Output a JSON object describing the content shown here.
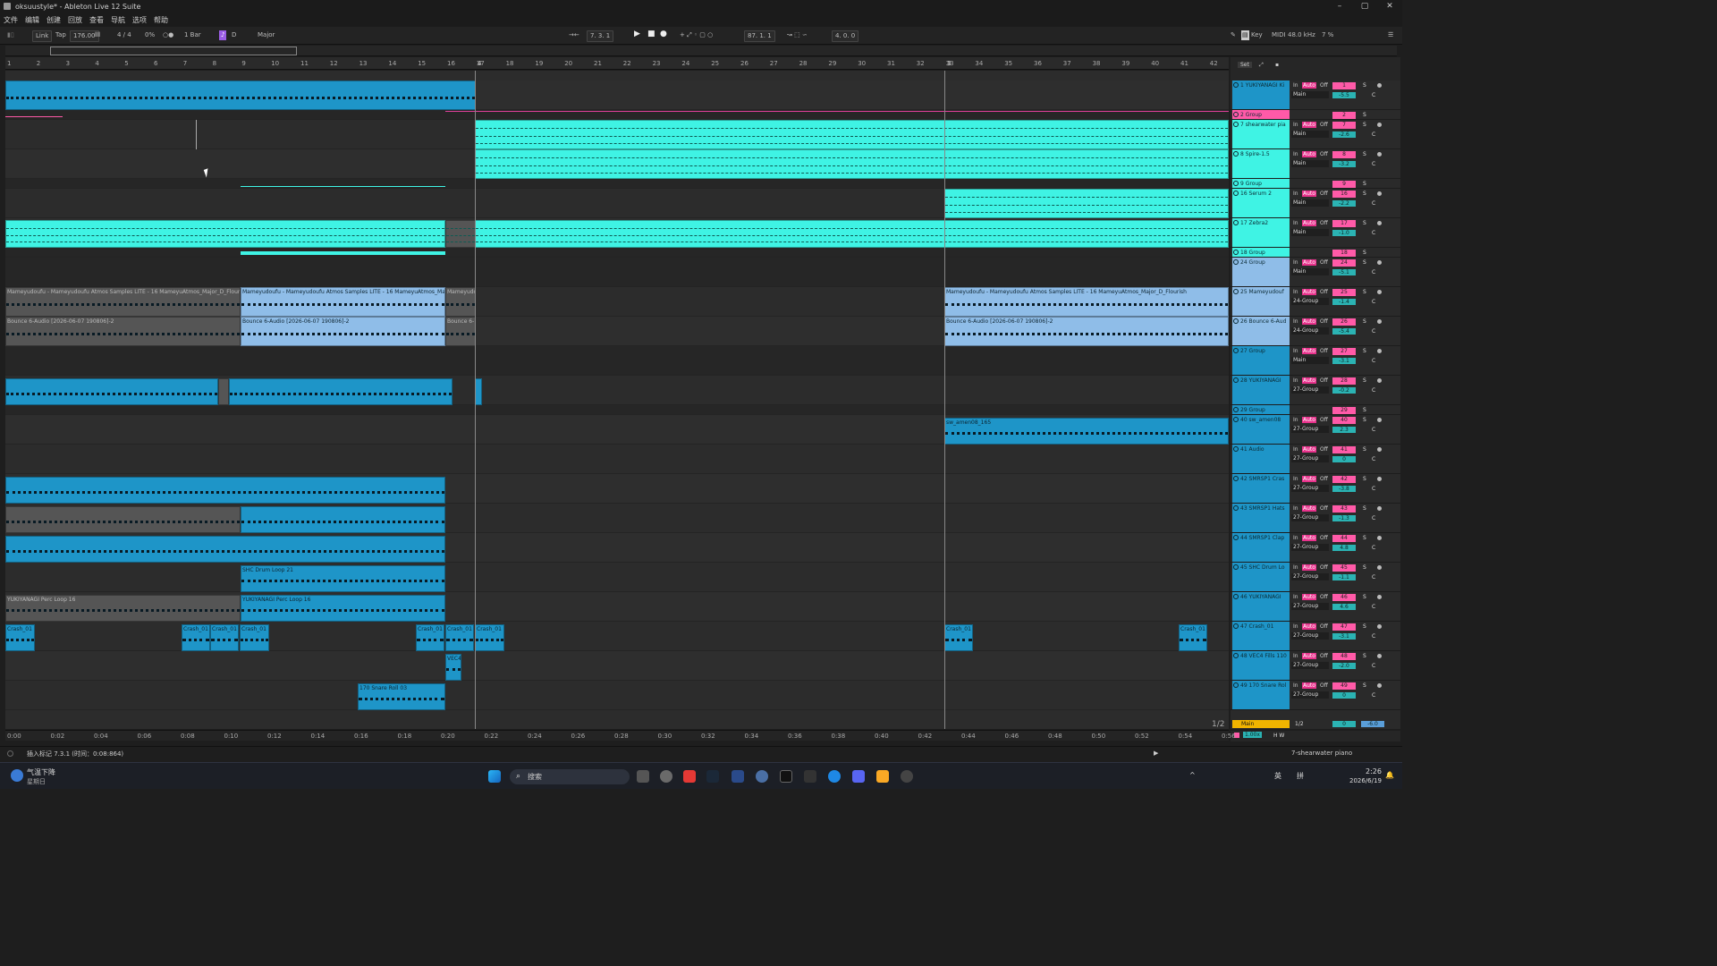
{
  "window": {
    "title": "oksuustyle* - Ableton Live 12 Suite",
    "controls": [
      "–",
      "▢",
      "✕"
    ]
  },
  "menu": [
    "文件",
    "编辑",
    "创建",
    "回放",
    "查看",
    "导航",
    "选项",
    "帮助"
  ],
  "control_bar": {
    "link": "Link",
    "tap": "Tap",
    "tempo": "176.00",
    "signature": "4 / 4",
    "groove": "0%",
    "quantize": "1 Bar",
    "key": "D",
    "scale": "Major",
    "position": "7.   3.   1",
    "loop_start": "87.   1.   1",
    "loop_length": "4.   0.   0",
    "key_label": "Key",
    "midi_label": "MIDI",
    "sample_rate": "48.0 kHz",
    "cpu": "7 %"
  },
  "ruler": {
    "bars": [
      "1",
      "2",
      "3",
      "4",
      "5",
      "6",
      "7",
      "8",
      "9",
      "10",
      "11",
      "12",
      "13",
      "14",
      "15",
      "16",
      "17",
      "18",
      "19",
      "20",
      "21",
      "22",
      "23",
      "24",
      "25",
      "26",
      "27",
      "28",
      "29",
      "30",
      "31",
      "32",
      "33",
      "34",
      "35",
      "36",
      "37",
      "38",
      "39",
      "40",
      "41",
      "42"
    ],
    "locators": [
      "4",
      "3"
    ],
    "set_label": "Set"
  },
  "timeline": [
    "0:00",
    "0:02",
    "0:04",
    "0:06",
    "0:08",
    "0:10",
    "0:12",
    "0:14",
    "0:16",
    "0:18",
    "0:20",
    "0:22",
    "0:24",
    "0:26",
    "0:28",
    "0:30",
    "0:32",
    "0:34",
    "0:36",
    "0:38",
    "0:40",
    "0:42",
    "0:44",
    "0:46",
    "0:48",
    "0:50",
    "0:52",
    "0:54",
    "0:56"
  ],
  "page_indicator": "1/2",
  "clips": {
    "mameyudoufu_a": "Mameyudoufu - Mameyudoufu Atmos Samples LITE - 16 MameyuAtmos_Major_D_Flourish",
    "mameyudoufu_b": "Mameyudoufu - Mameyudoufu Atmos Samples LITE - 16 MameyuAtmos_Major_D_Flourish",
    "mameyudoufu_c": "Mameyudoufu",
    "mameyudoufu_d": "Mameyudoufu - Mameyudoufu Atmos Samples LITE - 16 MameyuAtmos_Major_D_Flourish",
    "bounce_a": "Bounce 6-Audio [2026-06-07 190806]-2",
    "bounce_b": "Bounce 6-Audio [2026-06-07 190806]-2",
    "bounce_c": "Bounce 6-",
    "bounce_d": "Bounce 6-Audio [2026-06-07 190806]-2",
    "sw_amen": "sw_amen08_165",
    "shc_drum": "SHC Drum Loop 21",
    "perc_a": "YUKIYANAGI Perc Loop 16",
    "perc_b": "YUKIYANAGI Perc Loop 16",
    "crash": "Crash_01",
    "snare": "170 Snare Roll 03",
    "vec": "VEC4"
  },
  "tracks": [
    {
      "name": "1 YUKIYANAGI Ki",
      "num": "1",
      "route": "Main",
      "vol": "-5.5"
    },
    {
      "name": "2 Group",
      "num": "2"
    },
    {
      "name": "7 shearwater pia",
      "num": "7",
      "route": "Main",
      "vol": "-2.6"
    },
    {
      "name": "8 Spire-1.5",
      "num": "8",
      "route": "Main",
      "vol": "-3.2"
    },
    {
      "name": "9 Group",
      "num": "9"
    },
    {
      "name": "16 Serum 2",
      "num": "16",
      "route": "Main",
      "vol": "-2.2"
    },
    {
      "name": "17 Zebra2",
      "num": "17",
      "route": "Main",
      "vol": "-1.0"
    },
    {
      "name": "18 Group",
      "num": "18"
    },
    {
      "name": "24 Group",
      "num": "24",
      "route": "Main",
      "vol": "-5.1"
    },
    {
      "name": "25 Mameyudouf",
      "num": "25",
      "route": "24-Group",
      "vol": "-1.4"
    },
    {
      "name": "26 Bounce 6-Aud",
      "num": "26",
      "route": "24-Group",
      "vol": "-5.4"
    },
    {
      "name": "27 Group",
      "num": "27",
      "route": "Main",
      "vol": "-3.1"
    },
    {
      "name": "28 YUKIYANAGI",
      "num": "28",
      "route": "27-Group",
      "vol": "-0.2"
    },
    {
      "name": "29 Group",
      "num": "29"
    },
    {
      "name": "40 sw_amen08",
      "num": "40",
      "route": "27-Group",
      "vol": "2.3"
    },
    {
      "name": "41 Audio",
      "num": "41",
      "route": "27-Group",
      "vol": "0"
    },
    {
      "name": "42 SMRSP1 Cras",
      "num": "42",
      "route": "27-Group",
      "vol": "-3.8"
    },
    {
      "name": "43 SMRSP1 Hats",
      "num": "43",
      "route": "27-Group",
      "vol": "-1.3"
    },
    {
      "name": "44 SMRSP1 Clap",
      "num": "44",
      "route": "27-Group",
      "vol": "4.8"
    },
    {
      "name": "45 SHC Drum Lo",
      "num": "45",
      "route": "27-Group",
      "vol": "-1.1"
    },
    {
      "name": "46 YUKIYANAGI",
      "num": "46",
      "route": "27-Group",
      "vol": "4.6"
    },
    {
      "name": "47 Crash_01",
      "num": "47",
      "route": "27-Group",
      "vol": "-3.1"
    },
    {
      "name": "48 VEC4 Fills 110",
      "num": "48",
      "route": "27-Group",
      "vol": "-2.0"
    },
    {
      "name": "49 170 Snare Rol",
      "num": "49",
      "route": "27-Group",
      "vol": "0"
    }
  ],
  "track_buttons": {
    "in": "In",
    "auto": "Auto",
    "off": "Off",
    "solo": "S",
    "center": "C"
  },
  "master": {
    "name": "Main",
    "value": "1/2",
    "vol": "0",
    "vol2": "-6.0"
  },
  "zoom": "1.00x",
  "hw": "H W",
  "status": {
    "text": "插入标记 7.3.1 (时间：0:08:864)",
    "selected_track": "7-shearwater piano"
  },
  "taskbar": {
    "weather": "气温下降",
    "weather_sub": "星期日",
    "search": "搜索",
    "time": "2:26",
    "date": "2026/6/19",
    "lang1": "英",
    "lang2": "拼"
  }
}
